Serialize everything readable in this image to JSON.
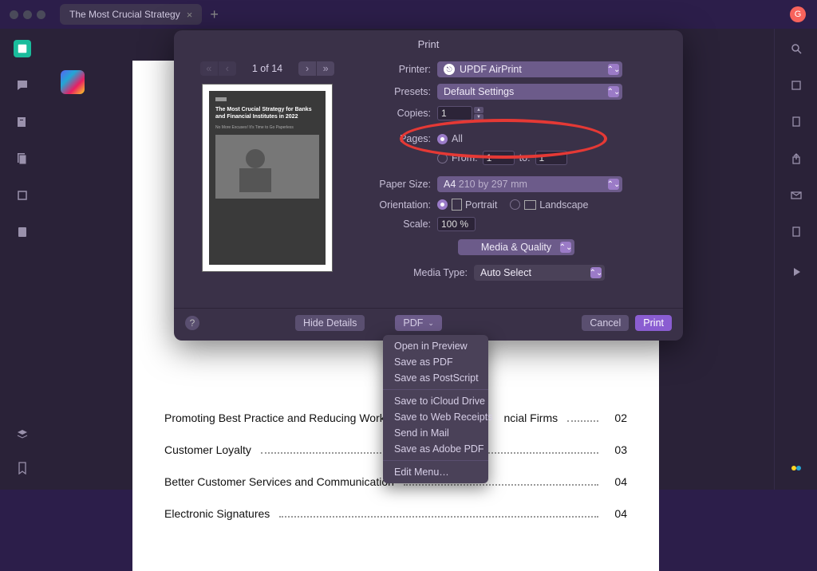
{
  "window": {
    "tab_title": "The Most Crucial Strategy",
    "avatar_letter": "G"
  },
  "print_dialog": {
    "title": "Print",
    "preview_counter": "1 of 14",
    "thumb_title": "The Most Crucial Strategy for Banks and Financial Institutes in 2022",
    "printer_label": "Printer:",
    "printer_value": "UPDF AirPrint",
    "presets_label": "Presets:",
    "presets_value": "Default Settings",
    "copies_label": "Copies:",
    "copies_value": "1",
    "pages_label": "Pages:",
    "pages_all": "All",
    "pages_from_label": "From:",
    "pages_from_value": "1",
    "pages_to_label": "to:",
    "pages_to_value": "1",
    "papersize_label": "Paper Size:",
    "papersize_value": "A4 210 by 297 mm",
    "orientation_label": "Orientation:",
    "orientation_portrait": "Portrait",
    "orientation_landscape": "Landscape",
    "scale_label": "Scale:",
    "scale_value": "100 %",
    "section_select": "Media & Quality",
    "mediatype_label": "Media Type:",
    "mediatype_value": "Auto Select",
    "hide_details": "Hide Details",
    "pdf_button": "PDF",
    "cancel_button": "Cancel",
    "print_button": "Print"
  },
  "pdf_menu": {
    "items": [
      "Open in Preview",
      "Save as PDF",
      "Save as PostScript",
      "Save to iCloud Drive",
      "Save to Web Receipts",
      "Send in Mail",
      "Save as Adobe PDF",
      "Edit Menu…"
    ]
  },
  "document": {
    "toc": [
      {
        "title": "Promoting Best Practice and Reducing Workloa",
        "suffix": "ncial Firms",
        "num": "02"
      },
      {
        "title": "Customer Loyalty",
        "suffix": "",
        "num": "03"
      },
      {
        "title": "Better Customer Services and Communication",
        "suffix": "",
        "num": "04"
      },
      {
        "title": "Electronic Signatures",
        "suffix": "",
        "num": "04"
      }
    ]
  }
}
